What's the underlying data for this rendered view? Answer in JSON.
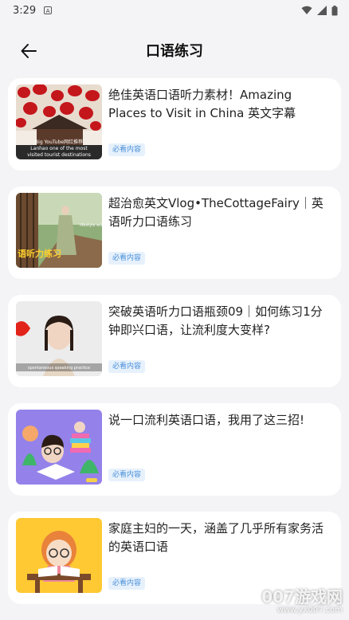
{
  "status": {
    "time": "3:29",
    "notification_icon": "A"
  },
  "header": {
    "title": "口语练习"
  },
  "items": [
    {
      "title": "绝佳英语口语听力素材！Amazing Places to Visit in China 英文字幕",
      "tag": "必看内容",
      "thumb_caption": "Big YouTube网红推荐 Lanhao one of the most visited tourist destinations"
    },
    {
      "title": "超治愈英文Vlog•TheCottageFairy｜英语听力口语练习",
      "tag": "必看内容",
      "thumb_caption": "语听力练习",
      "thumb_overlay": "lifestyle ech"
    },
    {
      "title": "突破英语听力口语瓶颈09｜如何练习1分钟即兴口语，让流利度大变样?",
      "tag": "必看内容"
    },
    {
      "title": "说一口流利英语口语，我用了这三招!",
      "tag": "必看内容"
    },
    {
      "title": "家庭主妇的一天，涵盖了几乎所有家务活的英语口语",
      "tag": "必看内容"
    }
  ],
  "watermark": {
    "brand": "007游戏网",
    "url": "www.yx007.com"
  }
}
